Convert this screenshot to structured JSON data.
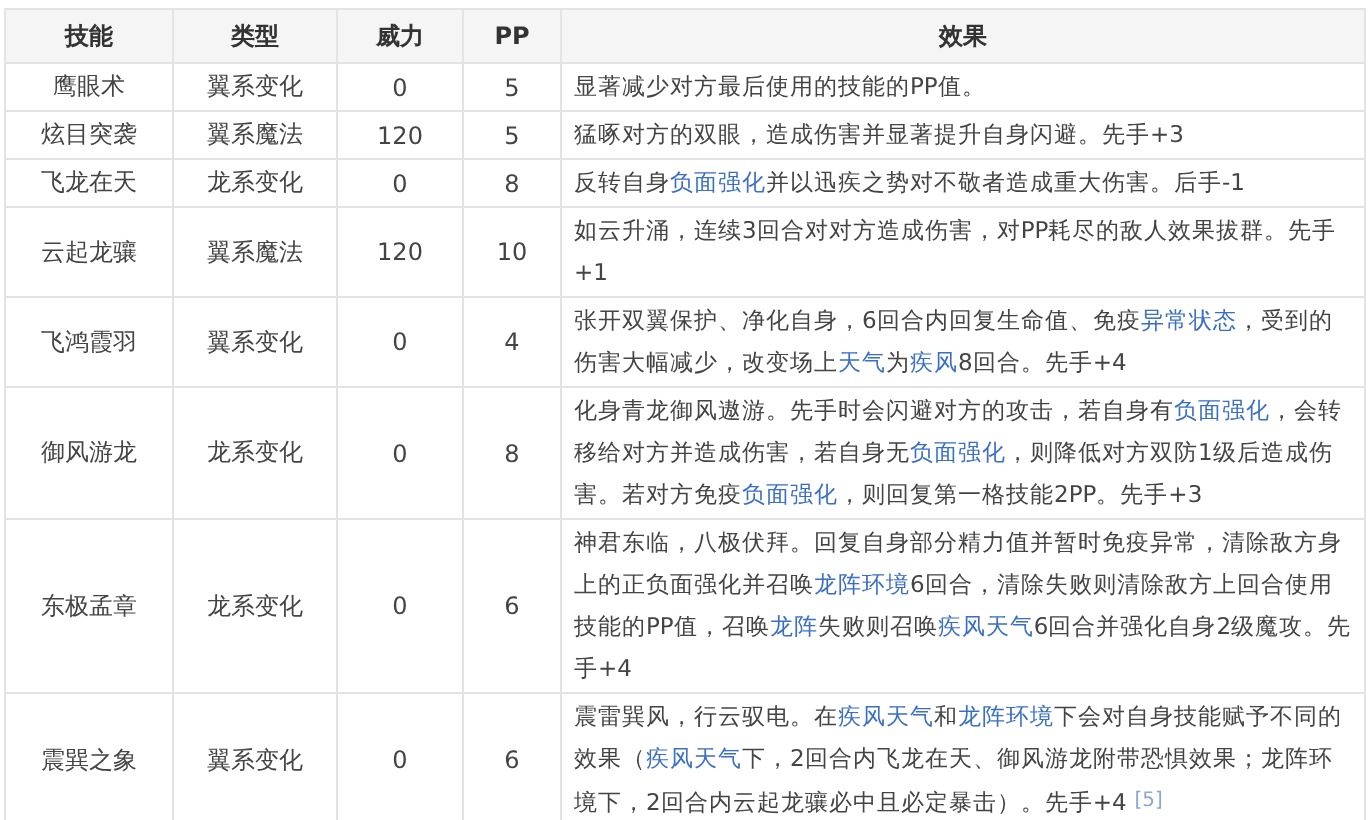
{
  "table": {
    "columns": [
      "技能",
      "类型",
      "威力",
      "PP",
      "效果"
    ],
    "rows": [
      {
        "name": "鹰眼术",
        "type": "翼系变化",
        "power": "0",
        "pp": "5",
        "effect": [
          {
            "kind": "text",
            "text": "显著减少对方最后使用的技能的PP值。"
          }
        ]
      },
      {
        "name": "炫目突袭",
        "type": "翼系魔法",
        "power": "120",
        "pp": "5",
        "effect": [
          {
            "kind": "text",
            "text": "猛啄对方的双眼，造成伤害并显著提升自身闪避。先手+3"
          }
        ]
      },
      {
        "name": "飞龙在天",
        "type": "龙系变化",
        "power": "0",
        "pp": "8",
        "effect": [
          {
            "kind": "text",
            "text": "反转自身"
          },
          {
            "kind": "link",
            "text": "负面强化"
          },
          {
            "kind": "text",
            "text": "并以迅疾之势对不敬者造成重大伤害。后手-1"
          }
        ]
      },
      {
        "name": "云起龙骧",
        "type": "翼系魔法",
        "power": "120",
        "pp": "10",
        "effect": [
          {
            "kind": "text",
            "text": "如云升涌，连续3回合对对方造成伤害，对PP耗尽的敌人效果拔群。先手+1"
          }
        ]
      },
      {
        "name": "飞鸿霞羽",
        "type": "翼系变化",
        "power": "0",
        "pp": "4",
        "effect": [
          {
            "kind": "text",
            "text": "张开双翼保护、净化自身，6回合内回复生命值、免疫"
          },
          {
            "kind": "link",
            "text": "异常状态"
          },
          {
            "kind": "text",
            "text": "，受到的伤害大幅减少，改变场上"
          },
          {
            "kind": "link",
            "text": "天气"
          },
          {
            "kind": "text",
            "text": "为"
          },
          {
            "kind": "link",
            "text": "疾风"
          },
          {
            "kind": "text",
            "text": "8回合。先手+4"
          }
        ]
      },
      {
        "name": "御风游龙",
        "type": "龙系变化",
        "power": "0",
        "pp": "8",
        "effect": [
          {
            "kind": "text",
            "text": "化身青龙御风遨游。先手时会闪避对方的攻击，若自身有"
          },
          {
            "kind": "link",
            "text": "负面强化"
          },
          {
            "kind": "text",
            "text": "，会转移给对方并造成伤害，若自身无"
          },
          {
            "kind": "link",
            "text": "负面强化"
          },
          {
            "kind": "text",
            "text": "，则降低对方双防1级后造成伤害。若对方免疫"
          },
          {
            "kind": "link",
            "text": "负面强化"
          },
          {
            "kind": "text",
            "text": "，则回复第一格技能2PP。先手+3"
          }
        ]
      },
      {
        "name": "东极孟章",
        "type": "龙系变化",
        "power": "0",
        "pp": "6",
        "effect": [
          {
            "kind": "text",
            "text": "神君东临，八极伏拜。回复自身部分精力值并暂时免疫异常，清除敌方身上的正负面强化并召唤"
          },
          {
            "kind": "link",
            "text": "龙阵环境"
          },
          {
            "kind": "text",
            "text": "6回合，清除失败则清除敌方上回合使用技能的PP值，召唤"
          },
          {
            "kind": "link",
            "text": "龙阵"
          },
          {
            "kind": "text",
            "text": "失败则召唤"
          },
          {
            "kind": "link",
            "text": "疾风天气"
          },
          {
            "kind": "text",
            "text": "6回合并强化自身2级魔攻。先手+4"
          }
        ]
      },
      {
        "name": "震巽之象",
        "type": "翼系变化",
        "power": "0",
        "pp": "6",
        "effect": [
          {
            "kind": "text",
            "text": "震雷巽风，行云驭电。在"
          },
          {
            "kind": "link",
            "text": "疾风天气"
          },
          {
            "kind": "text",
            "text": "和"
          },
          {
            "kind": "link",
            "text": "龙阵环境"
          },
          {
            "kind": "text",
            "text": "下会对自身技能赋予不同的效果（"
          },
          {
            "kind": "link",
            "text": "疾风天气"
          },
          {
            "kind": "text",
            "text": "下，2回合内飞龙在天、御风游龙附带恐惧效果；龙阵环境下，2回合内云起龙骧必中且必定暴击）。先手+4"
          },
          {
            "kind": "ref",
            "text": "[5]"
          }
        ]
      }
    ]
  }
}
